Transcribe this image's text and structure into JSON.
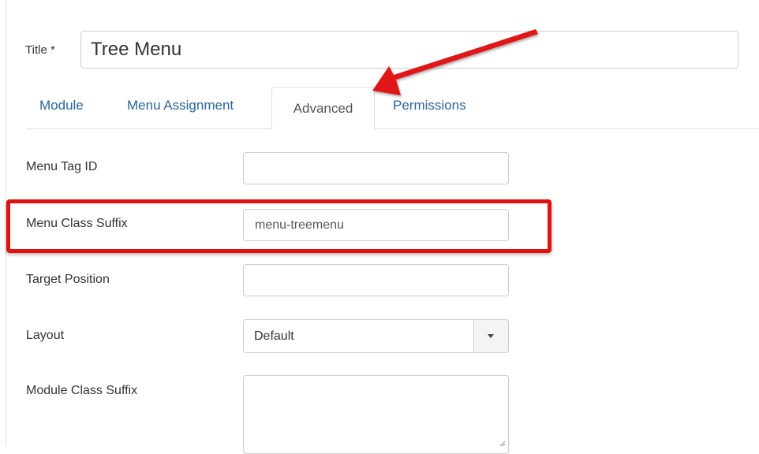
{
  "title_field": {
    "label": "Title *",
    "value": "Tree Menu"
  },
  "tabs": [
    {
      "label": "Module",
      "active": false
    },
    {
      "label": "Menu Assignment",
      "active": false
    },
    {
      "label": "Advanced",
      "active": true
    },
    {
      "label": "Permissions",
      "active": false
    }
  ],
  "fields": {
    "menu_tag_id": {
      "label": "Menu Tag ID",
      "value": ""
    },
    "menu_class_suffix": {
      "label": "Menu Class Suffix",
      "value": "menu-treemenu"
    },
    "target_position": {
      "label": "Target Position",
      "value": ""
    },
    "layout": {
      "label": "Layout",
      "value": "Default"
    },
    "module_class_suffix": {
      "label": "Module Class Suffix",
      "value": ""
    }
  },
  "annotation": {
    "color": "#e11212"
  },
  "colors": {
    "link": "#2a6496",
    "border": "#cccccc"
  }
}
